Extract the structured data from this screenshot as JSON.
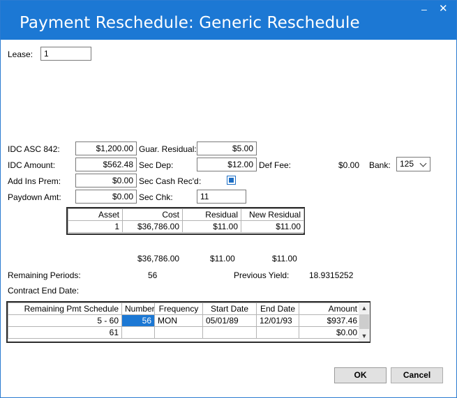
{
  "window": {
    "title": "Payment Reschedule: Generic Reschedule",
    "minimize_glyph": "–",
    "close_glyph": "✕"
  },
  "lease": {
    "label": "Lease:",
    "value": "1"
  },
  "form": {
    "idc_asc_842": {
      "label": "IDC ASC 842:",
      "value": "$1,200.00"
    },
    "idc_amount": {
      "label": "IDC Amount:",
      "value": "$562.48"
    },
    "add_ins_prem": {
      "label": "Add Ins Prem:",
      "value": "$0.00"
    },
    "paydown_amt": {
      "label": "Paydown Amt:",
      "value": "$0.00"
    },
    "guar_residual": {
      "label": "Guar. Residual:",
      "value": "$5.00"
    },
    "sec_dep": {
      "label": "Sec Dep:",
      "value": "$12.00"
    },
    "sec_cash_recd": {
      "label": "Sec Cash Rec'd",
      "colon": ":",
      "checked": true
    },
    "sec_chk": {
      "label": "Sec Chk:",
      "value": "11"
    },
    "def_fee": {
      "label": "Def Fee:",
      "value": "$0.00"
    },
    "bank": {
      "label": "Bank:",
      "value": "125"
    }
  },
  "asset_table": {
    "headers": [
      "Asset",
      "Cost",
      "Residual",
      "New Residual"
    ],
    "rows": [
      [
        "1",
        "$36,786.00",
        "$11.00",
        "$11.00"
      ]
    ]
  },
  "totals": {
    "cost": "$36,786.00",
    "residual": "$11.00",
    "new_residual": "$11.00"
  },
  "summary": {
    "remaining_periods_label": "Remaining Periods:",
    "remaining_periods_value": "56",
    "previous_yield_label": "Previous Yield:",
    "previous_yield_value": "18.9315252",
    "contract_end_date_label": "Contract End Date:"
  },
  "schedule_table": {
    "headers": [
      "Remaining Pmt Schedule",
      "Number",
      "Frequency",
      "Start Date",
      "End Date",
      "Amount"
    ],
    "rows": [
      [
        "5 - 60",
        "56",
        "MON",
        "05/01/89",
        "12/01/93",
        "$937.46"
      ],
      [
        "61",
        "",
        "",
        "",
        "",
        "$0.00"
      ]
    ]
  },
  "buttons": {
    "ok": "OK",
    "cancel": "Cancel"
  },
  "colors": {
    "accent": "#1c78d4"
  }
}
